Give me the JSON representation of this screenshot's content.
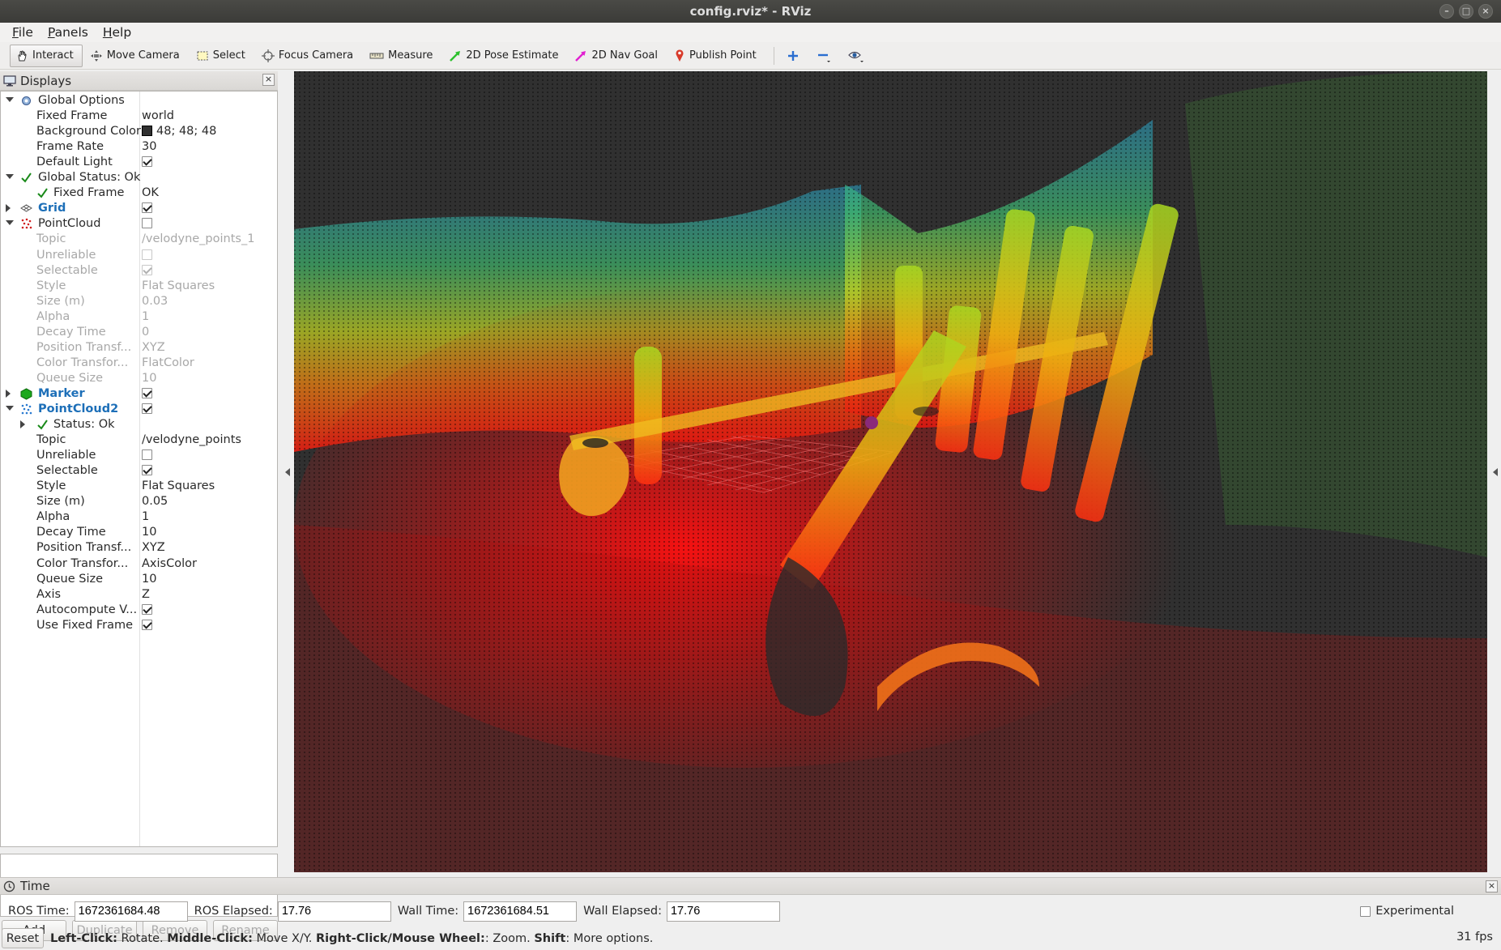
{
  "window": {
    "title": "config.rviz* - RViz"
  },
  "menu": [
    "File",
    "Panels",
    "Help"
  ],
  "toolbar": {
    "tools": [
      {
        "label": "Interact",
        "icon": "hand-icon",
        "active": true
      },
      {
        "label": "Move Camera",
        "icon": "move-camera-icon"
      },
      {
        "label": "Select",
        "icon": "select-icon"
      },
      {
        "label": "Focus Camera",
        "icon": "focus-camera-icon"
      },
      {
        "label": "Measure",
        "icon": "ruler-icon"
      },
      {
        "label": "2D Pose Estimate",
        "icon": "pose-estimate-arrow-icon"
      },
      {
        "label": "2D Nav Goal",
        "icon": "nav-goal-arrow-icon"
      },
      {
        "label": "Publish Point",
        "icon": "map-pin-icon"
      }
    ],
    "extra_icons": [
      "plus-icon",
      "minus-icon",
      "eye-icon"
    ]
  },
  "displays": {
    "title": "Displays",
    "tree": [
      {
        "indent": 0,
        "arrow": "down",
        "icon": "gear-icon",
        "label": "Global Options",
        "value": ""
      },
      {
        "indent": 1,
        "label": "Fixed Frame",
        "value": "world"
      },
      {
        "indent": 1,
        "label": "Background Color",
        "value": "48; 48; 48",
        "swatch": "#303030"
      },
      {
        "indent": 1,
        "label": "Frame Rate",
        "value": "30"
      },
      {
        "indent": 1,
        "label": "Default Light",
        "check": true
      },
      {
        "indent": 0,
        "arrow": "down",
        "icon": "checkmark-icon",
        "label": "Global Status: Ok"
      },
      {
        "indent": 1,
        "icon": "checkmark-icon",
        "label": "Fixed Frame",
        "value": "OK",
        "subicon": true
      },
      {
        "indent": 0,
        "arrow": "right",
        "icon": "grid-icon",
        "label": "Grid",
        "check": true,
        "blue": true
      },
      {
        "indent": 0,
        "arrow": "down",
        "icon": "pointcloud-icon",
        "label": "PointCloud",
        "check": false
      },
      {
        "indent": 1,
        "label": "Topic",
        "value": "/velodyne_points_1",
        "disabled": true
      },
      {
        "indent": 1,
        "label": "Unreliable",
        "check": false,
        "disabled": true
      },
      {
        "indent": 1,
        "label": "Selectable",
        "check": true,
        "disabled": true
      },
      {
        "indent": 1,
        "label": "Style",
        "value": "Flat Squares",
        "disabled": true
      },
      {
        "indent": 1,
        "label": "Size (m)",
        "value": "0.03",
        "disabled": true
      },
      {
        "indent": 1,
        "label": "Alpha",
        "value": "1",
        "disabled": true
      },
      {
        "indent": 1,
        "label": "Decay Time",
        "value": "0",
        "disabled": true
      },
      {
        "indent": 1,
        "label": "Position Transf...",
        "value": "XYZ",
        "disabled": true
      },
      {
        "indent": 1,
        "label": "Color Transfor...",
        "value": "FlatColor",
        "disabled": true
      },
      {
        "indent": 1,
        "label": "Queue Size",
        "value": "10",
        "disabled": true
      },
      {
        "indent": 0,
        "arrow": "right",
        "icon": "marker-icon",
        "label": "Marker",
        "check": true,
        "blue": true
      },
      {
        "indent": 0,
        "arrow": "down",
        "icon": "pointcloud2-icon",
        "label": "PointCloud2",
        "check": true,
        "blue": true
      },
      {
        "indent": 1,
        "arrow": "right",
        "icon": "checkmark-icon",
        "label": "Status: Ok",
        "subicon": true
      },
      {
        "indent": 1,
        "label": "Topic",
        "value": "/velodyne_points"
      },
      {
        "indent": 1,
        "label": "Unreliable",
        "check": false
      },
      {
        "indent": 1,
        "label": "Selectable",
        "check": true
      },
      {
        "indent": 1,
        "label": "Style",
        "value": "Flat Squares"
      },
      {
        "indent": 1,
        "label": "Size (m)",
        "value": "0.05"
      },
      {
        "indent": 1,
        "label": "Alpha",
        "value": "1"
      },
      {
        "indent": 1,
        "label": "Decay Time",
        "value": "10"
      },
      {
        "indent": 1,
        "label": "Position Transf...",
        "value": "XYZ"
      },
      {
        "indent": 1,
        "label": "Color Transfor...",
        "value": "AxisColor"
      },
      {
        "indent": 1,
        "label": "Queue Size",
        "value": "10"
      },
      {
        "indent": 1,
        "label": "Axis",
        "value": "Z"
      },
      {
        "indent": 1,
        "label": "Autocompute V...",
        "check": true
      },
      {
        "indent": 1,
        "label": "Use Fixed Frame",
        "check": true
      }
    ],
    "buttons": [
      {
        "label": "Add",
        "disabled": false
      },
      {
        "label": "Duplicate",
        "disabled": true
      },
      {
        "label": "Remove",
        "disabled": true
      },
      {
        "label": "Rename",
        "disabled": true
      }
    ]
  },
  "viewport": {
    "background": "#303030"
  },
  "time": {
    "title": "Time",
    "ros_time_label": "ROS Time:",
    "ros_time": "1672361684.48",
    "ros_elapsed_label": "ROS Elapsed:",
    "ros_elapsed": "17.76",
    "wall_time_label": "Wall Time:",
    "wall_time": "1672361684.51",
    "wall_elapsed_label": "Wall Elapsed:",
    "wall_elapsed": "17.76",
    "experimental": "Experimental"
  },
  "status": {
    "reset": "Reset",
    "hint": [
      {
        "b": "Left-Click:",
        "t": " Rotate. "
      },
      {
        "b": "Middle-Click:",
        "t": " Move X/Y. "
      },
      {
        "b": "Right-Click/Mouse Wheel:",
        "t": ": Zoom. "
      },
      {
        "b": "Shift",
        "t": ": More options."
      }
    ],
    "fps": "31 fps"
  }
}
